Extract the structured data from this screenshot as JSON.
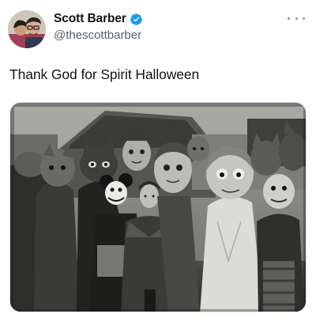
{
  "tweet": {
    "author": {
      "display_name": "Scott Barber",
      "handle": "@thescottbarber",
      "verified": true,
      "verified_color": "#1d9bf0"
    },
    "text": "Thank God for Spirit Halloween",
    "media": {
      "type": "photo",
      "style": "black-and-white vintage photograph",
      "icon": "photo"
    },
    "more_icon": "ellipsis-horizontal-icon"
  }
}
